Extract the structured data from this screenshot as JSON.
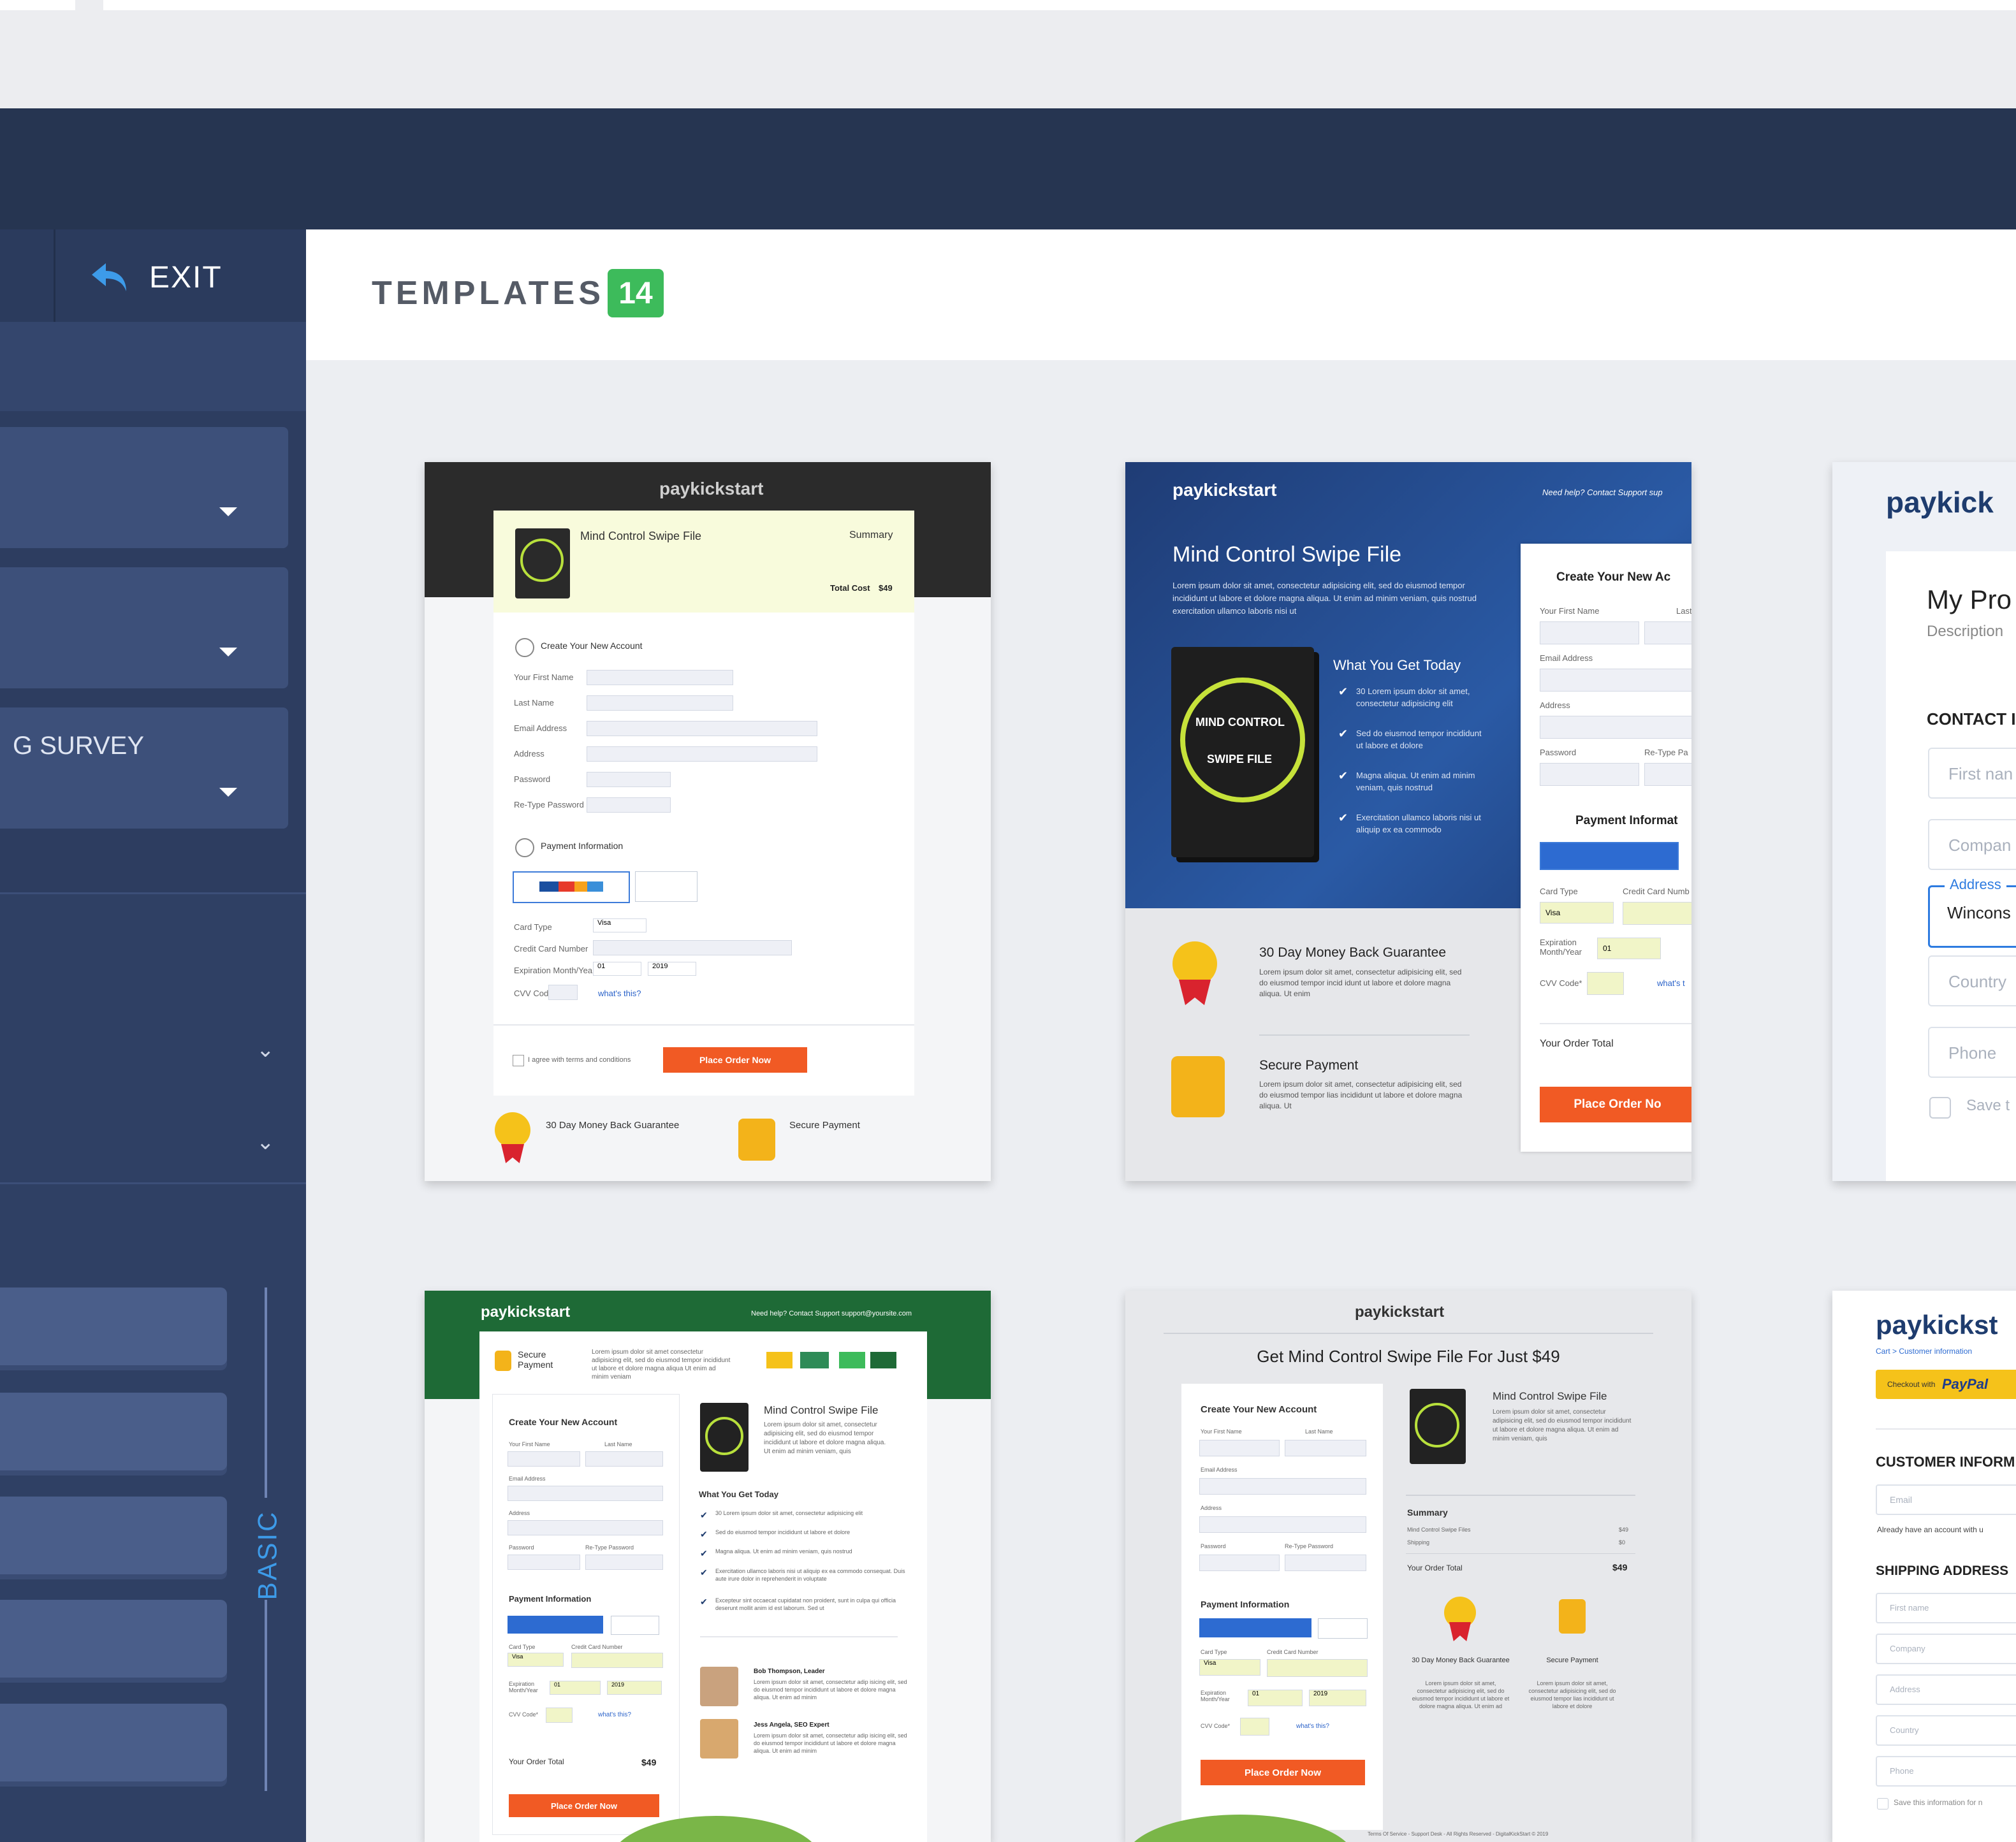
{
  "sidebar": {
    "exit_label": "EXIT",
    "dropdown_survey": "G SURVEY",
    "group_label": "BASIC"
  },
  "main": {
    "title": "TEMPLATES",
    "count": "14"
  },
  "templates": [
    {
      "logo": "paykickstart",
      "product": "Mind Control Swipe File",
      "summary": "Summary",
      "total": "Total Cost",
      "total_value": "$49",
      "step1": "Create Your New Account",
      "f1": "Your First Name",
      "f2": "Last Name",
      "f3": "Email Address",
      "f4": "Address",
      "f5": "Password",
      "f6": "Re-Type Password",
      "step2": "Payment Information",
      "card_type": "Card Type",
      "card_type_val": "Visa",
      "card_number": "Credit Card Number",
      "exp": "Expiration Month/Year",
      "exp_m": "01",
      "exp_y": "2019",
      "cvv": "CVV Code*",
      "whats": "what's this?",
      "agree": "I agree with terms and conditions",
      "cta": "Place Order Now",
      "g1": "30 Day Money Back Guarantee",
      "g2": "Secure Payment"
    },
    {
      "logo": "paykickstart",
      "help": "Need help? Contact Support sup",
      "product": "Mind Control Swipe File",
      "desc": "Lorem ipsum dolor sit amet, consectetur adipisicing elit, sed do eiusmod tempor incididunt ut labore et dolore magna aliqua. Ut enim ad minim veniam, quis nostrud exercitation ullamco laboris nisi ut",
      "get_today": "What You Get Today",
      "b1": "30 Lorem ipsum dolor sit amet, consectetur adipisicing elit",
      "b2": "Sed do eiusmod tempor incididunt ut labore et dolore",
      "b3": "Magna aliqua. Ut enim ad minim veniam, quis nostrud",
      "b4": "Exercitation ullamco laboris nisi ut aliquip ex ea commodo",
      "form_title": "Create Your New Ac",
      "f1": "Your First Name",
      "f1b": "Last",
      "f2": "Email Address",
      "f3": "Address",
      "f4": "Password",
      "f4b": "Re-Type Pa",
      "pay": "Payment Informat",
      "card_type": "Card Type",
      "card_type_val": "Visa",
      "card_number": "Credit Card Numb",
      "exp": "Expiration Month/Year",
      "exp_m": "01",
      "cvv": "CVV Code*",
      "whats": "what's t",
      "order_total": "Your Order Total",
      "cta": "Place Order No",
      "g1": "30 Day Money Back Guarantee",
      "g1d": "Lorem ipsum dolor sit amet, consectetur adipisicing elit, sed do eiusmod tempor incid idunt ut labore et dolore magna aliqua. Ut enim",
      "g2": "Secure Payment",
      "g2d": "Lorem ipsum dolor sit amet, consectetur adipisicing elit, sed do eiusmod tempor lias incididunt ut labore et dolore magna aliqua. Ut",
      "book_line1": "MIND CONTROL",
      "book_line2": "SWIPE FILE"
    },
    {
      "logo": "paykick",
      "product": "My Pro",
      "desc": "Description",
      "contact": "CONTACT I",
      "p1": "First nan",
      "p2": "Compan",
      "addr_label": "Address",
      "addr_val": "Wincons",
      "p3": "Country",
      "p4": "Phone",
      "save": "Save t"
    },
    {
      "logo": "paykickstart",
      "help": "Need help? Contact Support support@yoursite.com",
      "secure": "Secure Payment",
      "secure_desc": "Lorem ipsum dolor sit amet consectetur adipisicing elit, sed do eiusmod tempor incididunt ut labore et dolore magna aliqua Ut enim ad minim veniam",
      "form_title": "Create Your New Account",
      "f1": "Your First Name",
      "f1b": "Last Name",
      "f2": "Email Address",
      "f3": "Address",
      "f4": "Password",
      "f4b": "Re-Type Password",
      "pay": "Payment Information",
      "card_type": "Card Type",
      "card_type_val": "Visa",
      "card_number": "Credit Card Number",
      "exp": "Expiration Month/Year",
      "exp_m": "01",
      "exp_y": "2019",
      "cvv": "CVV Code*",
      "whats": "what's this?",
      "order_total": "Your Order Total",
      "order_val": "$49",
      "cta": "Place Order Now",
      "product": "Mind Control Swipe File",
      "pdesc": "Lorem ipsum dolor sit amet, consectetur adipisicing elit, sed do eiusmod tempor incididunt ut labore et dolore magna aliqua. Ut enim ad minim veniam, quis",
      "get_today": "What You Get Today",
      "b1": "30 Lorem ipsum dolor sit amet, consectetur adipisicing elit",
      "b2": "Sed do eiusmod tempor incididunt ut labore et dolore",
      "b3": "Magna aliqua. Ut enim ad minim veniam, quis nostrud",
      "b4": "Exercitation ullamco laboris nisi ut aliquip ex ea commodo consequat. Duis aute irure dolor in reprehenderit in voluptate",
      "b5": "Excepteur sint occaecat cupidatat non proident, sunt in culpa qui officia deserunt mollit anim id est laborum. Sed ut",
      "t1": "Bob Thompson, Leader",
      "t1d": "Lorem ipsum dolor sit amet, consectetur adip isicing elit, sed do eiusmod tempor incididunt ut labore et dolore magna aliqua. Ut enim ad minim",
      "t2": "Jess Angela, SEO Expert",
      "t2d": "Lorem ipsum dolor sit amet, consectetur adip isicing elit, sed do eiusmod tempor incididunt ut labore et dolore magna aliqua. Ut enim ad minim"
    },
    {
      "logo": "paykickstart",
      "headline": "Get Mind Control Swipe File For Just $49",
      "form_title": "Create Your New Account",
      "f1": "Your First Name",
      "f1b": "Last Name",
      "f2": "Email Address",
      "f3": "Address",
      "f4": "Password",
      "f4b": "Re-Type Password",
      "pay": "Payment Information",
      "card_type": "Card Type",
      "card_type_val": "Visa",
      "card_number": "Credit Card Number",
      "exp": "Expiration Month/Year",
      "exp_m": "01",
      "exp_y": "2019",
      "cvv": "CVV Code*",
      "whats": "what's this?",
      "cta": "Place Order Now",
      "product": "Mind Control Swipe File",
      "pdesc": "Lorem ipsum dolor sit amet, consectetur adipisicing elit, sed do eiusmod tempor incididunt ut labore et dolore magna aliqua. Ut enim ad minim veniam, quis",
      "summary": "Summary",
      "s1": "Mind Control Swipe Files",
      "s1v": "$49",
      "s2": "Shipping",
      "s2v": "$0",
      "s3": "Your Order Total",
      "s3v": "$49",
      "g1": "30 Day Money Back Guarantee",
      "g1d": "Lorem ipsum dolor sit amet, consectetur adipisicing elit, sed do eiusmod tempor incididunt ut labore et dolore magna aliqua. Ut enim ad",
      "g2": "Secure Payment",
      "g2d": "Lorem ipsum dolor sit amet, consectetur adipisicing elit, sed do eiusmod tempor lias incididunt ut labore et dolore",
      "footer": "Terms Of Service - Support Desk - All Rights Reserved - DigitalKickStart © 2019"
    },
    {
      "logo": "paykickst",
      "crumb": "Cart > Customer information",
      "paypal_pre": "Checkout with",
      "paypal": "PayPal",
      "cust": "CUSTOMER INFORM",
      "email": "Email",
      "already": "Already have an account with u",
      "ship": "SHIPPING ADDRESS",
      "s1": "First name",
      "s2": "Company",
      "s3": "Address",
      "s4": "Country",
      "s5": "Phone",
      "save": "Save this information for n"
    }
  ]
}
